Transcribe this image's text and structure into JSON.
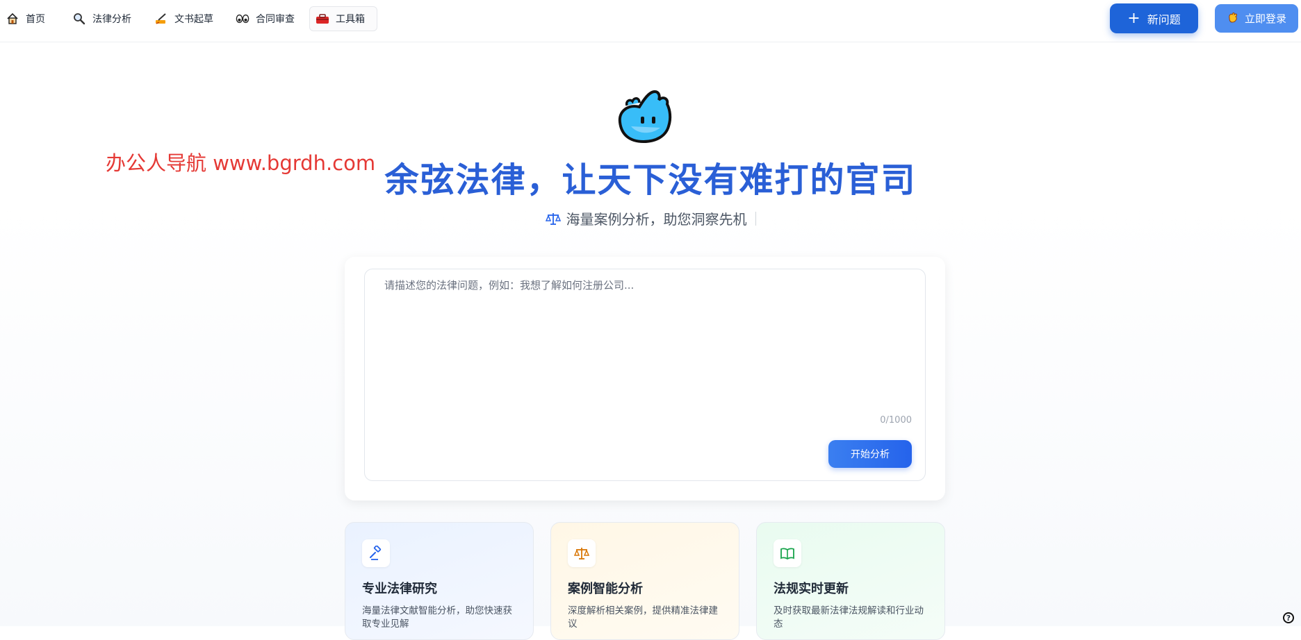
{
  "nav": {
    "items": [
      {
        "label": "首页",
        "icon": "house-icon"
      },
      {
        "label": "法律分析",
        "icon": "magnifier-icon"
      },
      {
        "label": "文书起草",
        "icon": "writing-hand-icon"
      },
      {
        "label": "合同审查",
        "icon": "eyes-icon"
      },
      {
        "label": "工具箱",
        "icon": "toolbox-icon"
      }
    ],
    "active_index": 4
  },
  "header": {
    "new_button_label": "新问题",
    "login_button_label": "立即登录"
  },
  "watermark": "办公人导航 www.bgrdh.com",
  "hero": {
    "title": "余弦法律，让天下没有难打的官司",
    "subtitle": "海量案例分析，助您洞察先机"
  },
  "query": {
    "placeholder": "请描述您的法律问题，例如：我想了解如何注册公司...",
    "value": "",
    "counter": "0/1000",
    "submit_label": "开始分析"
  },
  "features": [
    {
      "title": "专业法律研究",
      "desc": "海量法律文献智能分析，助您快速获取专业见解",
      "icon": "gavel-icon",
      "color": "#2563eb"
    },
    {
      "title": "案例智能分析",
      "desc": "深度解析相关案例，提供精准法律建议",
      "icon": "scale-icon",
      "color": "#d97706"
    },
    {
      "title": "法规实时更新",
      "desc": "及时获取最新法律法规解读和行业动态",
      "icon": "book-icon",
      "color": "#16a34a"
    }
  ],
  "help_label": "?"
}
